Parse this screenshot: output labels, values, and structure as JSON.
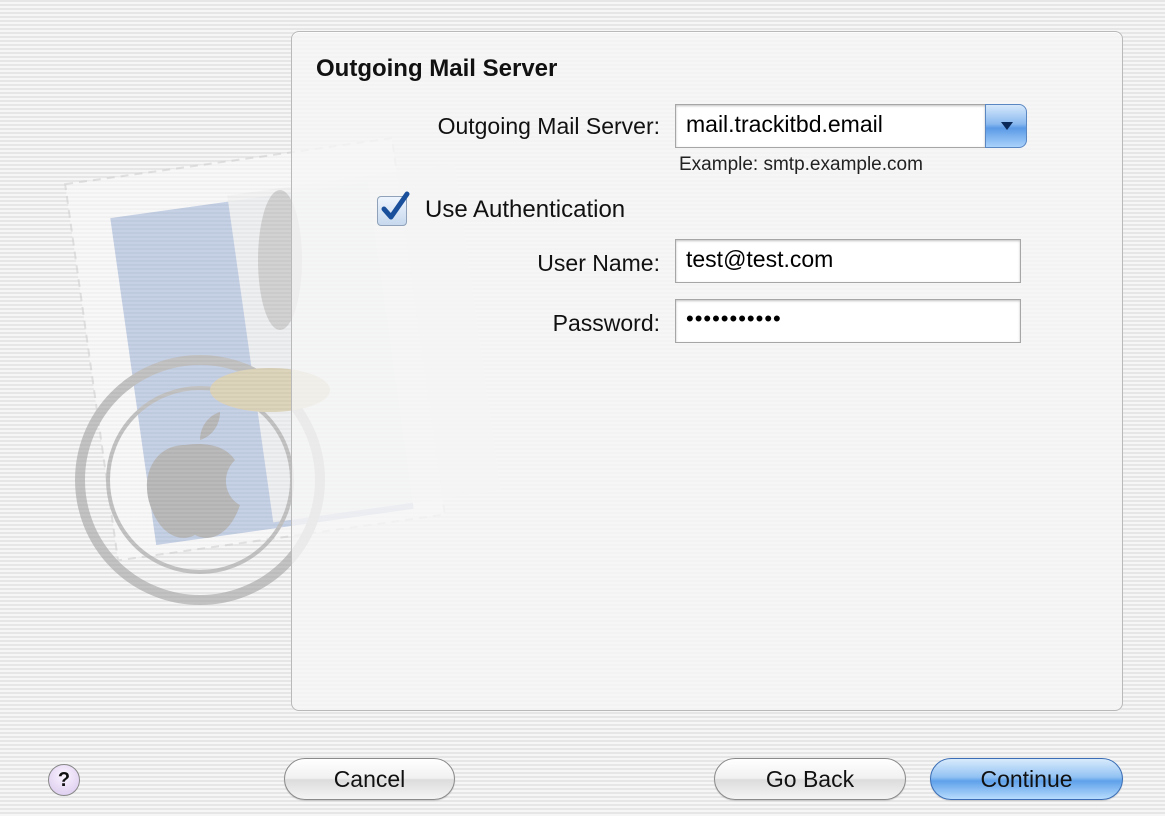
{
  "panel": {
    "title": "Outgoing Mail Server"
  },
  "form": {
    "server_label": "Outgoing Mail Server:",
    "server_value": "mail.trackitbd.email",
    "server_example": "Example: smtp.example.com",
    "use_auth_label": "Use Authentication",
    "use_auth_checked": true,
    "username_label": "User Name:",
    "username_value": "test@test.com",
    "password_label": "Password:",
    "password_display": "•••••••••••"
  },
  "buttons": {
    "help": "?",
    "cancel": "Cancel",
    "go_back": "Go Back",
    "continue": "Continue"
  },
  "icons": {
    "dropdown": "chevron-down-icon",
    "checkbox": "checkmark-icon",
    "stamp": "mail-stamp-icon"
  },
  "colors": {
    "default_button": "#5fa1ea",
    "dropdown_button": "#5b9ae6",
    "checkbox_check": "#1a4f9c",
    "help_button": "#d7c6ec"
  }
}
